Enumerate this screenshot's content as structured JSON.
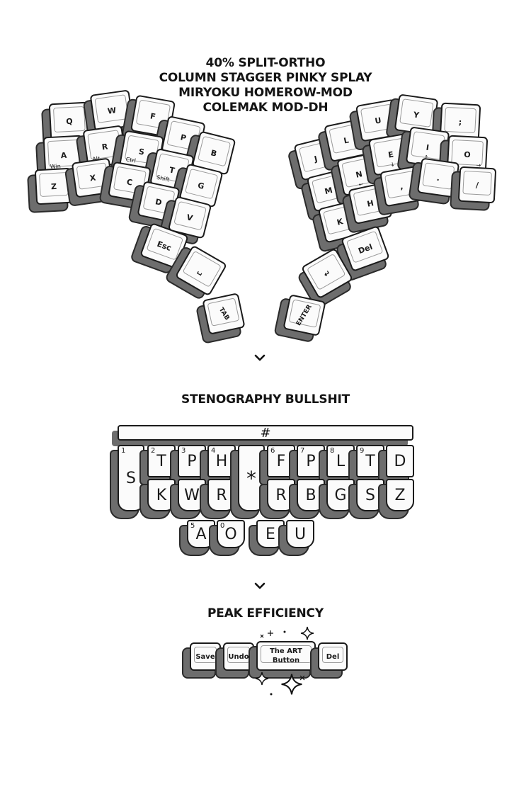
{
  "sections": {
    "split": {
      "title_lines": [
        "40% SPLIT-ORTHO",
        "COLUMN STAGGER PINKY SPLAY",
        "MIRYOKU HOMEROW-MOD",
        "COLEMAK MOD-DH"
      ]
    },
    "steno": {
      "title": "STENOGRAPHY BULLSHIT",
      "number_bar": "#"
    },
    "peak": {
      "title": "PEAK EFFICIENCY"
    }
  },
  "left_keys": [
    {
      "label": "Q"
    },
    {
      "label": "W"
    },
    {
      "label": "F"
    },
    {
      "label": "P"
    },
    {
      "label": "B"
    },
    {
      "label": "A",
      "sub": "Win"
    },
    {
      "label": "R",
      "sub": "Alt"
    },
    {
      "label": "S",
      "sub": "Ctrl"
    },
    {
      "label": "T",
      "sub": "Shift"
    },
    {
      "label": "G"
    },
    {
      "label": "Z"
    },
    {
      "label": "X"
    },
    {
      "label": "C"
    },
    {
      "label": "D"
    },
    {
      "label": "V"
    },
    {
      "label": "Esc"
    },
    {
      "label": "␣"
    },
    {
      "label": "TAB"
    }
  ],
  "right_keys": [
    {
      "label": "J"
    },
    {
      "label": "L"
    },
    {
      "label": "U"
    },
    {
      "label": "Y"
    },
    {
      "label": ";"
    },
    {
      "label": "M"
    },
    {
      "label": "N",
      "sub": "←"
    },
    {
      "label": "E",
      "sub": "↓"
    },
    {
      "label": "I",
      "sub": "↑"
    },
    {
      "label": "O",
      "sub": "→"
    },
    {
      "label": "K"
    },
    {
      "label": "H"
    },
    {
      "label": ","
    },
    {
      "label": "."
    },
    {
      "label": "/"
    },
    {
      "label": "Del"
    },
    {
      "label": "↵"
    },
    {
      "label": "ENTER"
    }
  ],
  "steno_keys": {
    "s": "S",
    "star": "*",
    "top_left": [
      {
        "label": "T",
        "num": "2"
      },
      {
        "label": "P",
        "num": "3"
      },
      {
        "label": "H",
        "num": "4"
      }
    ],
    "bottom_left": [
      "K",
      "W",
      "R"
    ],
    "top_right": [
      {
        "label": "F",
        "num": "6"
      },
      {
        "label": "P",
        "num": "7"
      },
      {
        "label": "L",
        "num": "8"
      },
      {
        "label": "T",
        "num": "9"
      },
      {
        "label": "D",
        "num": ""
      }
    ],
    "bottom_right": [
      "R",
      "B",
      "G",
      "S",
      "Z"
    ],
    "vowels": [
      {
        "label": "A",
        "num": "5"
      },
      {
        "label": "O",
        "num": "0"
      },
      {
        "label": "E",
        "num": ""
      },
      {
        "label": "U",
        "num": ""
      }
    ],
    "s_num": "1"
  },
  "peak_keys": {
    "save": "Save",
    "undo": "Undo",
    "art": "The ART Button",
    "del": "Del"
  }
}
